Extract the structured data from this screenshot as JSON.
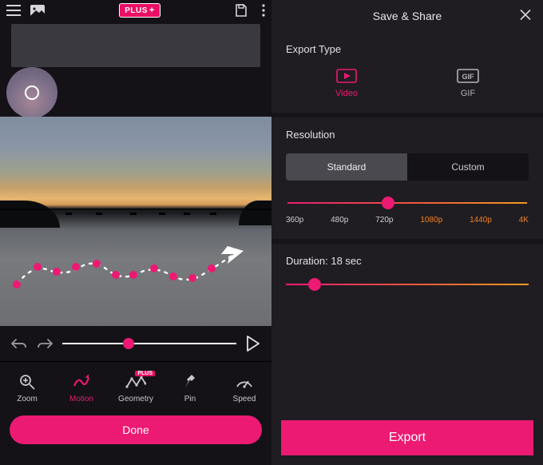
{
  "topbar": {
    "plus_badge": "PLUS"
  },
  "tools": {
    "zoom": "Zoom",
    "motion": "Motion",
    "geometry": "Geometry",
    "geometry_badge": "PLUS",
    "pin": "Pin",
    "speed": "Speed"
  },
  "done_label": "Done",
  "right": {
    "title": "Save & Share",
    "export_type_label": "Export Type",
    "video_label": "Video",
    "gif_label": "GIF",
    "resolution_label": "Resolution",
    "standard": "Standard",
    "custom": "Custom",
    "res": {
      "r360": "360p",
      "r480": "480p",
      "r720": "720p",
      "r1080": "1080p",
      "r1440": "1440p",
      "r4k": "4K"
    },
    "duration_label": "Duration: 18 sec",
    "export_label": "Export"
  },
  "colors": {
    "accent": "#ec1a72",
    "accent_orange": "#f5821f"
  }
}
